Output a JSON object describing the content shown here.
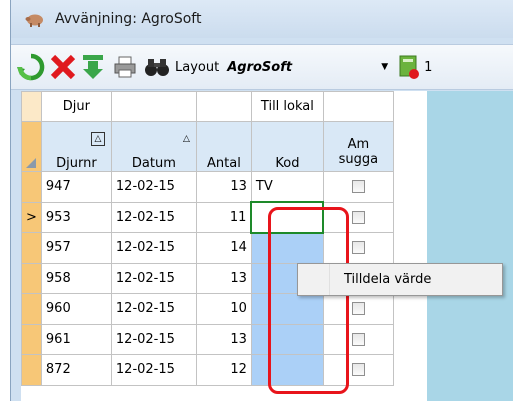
{
  "window": {
    "title": "Avvänjning: AgroSoft"
  },
  "toolbar": {
    "refresh_icon": "refresh-icon",
    "delete_icon": "delete-x-icon",
    "download_icon": "download-icon",
    "print_icon": "print-icon",
    "binoculars_icon": "binoculars-icon",
    "layout_label": "Layout",
    "layout_value": "AgroSoft",
    "trailing_text": "1"
  },
  "grid": {
    "group_headers": [
      "Djur",
      "",
      "",
      "Till lokal",
      ""
    ],
    "columns": [
      "Djurnr",
      "Datum",
      "Antal",
      "Kod",
      "Am sugga"
    ],
    "rows": [
      {
        "marker": "",
        "djurnr": "947",
        "datum": "12-02-15",
        "antal": "13",
        "kod": "TV"
      },
      {
        "marker": ">",
        "djurnr": "953",
        "datum": "12-02-15",
        "antal": "11",
        "kod": ""
      },
      {
        "marker": "",
        "djurnr": "957",
        "datum": "12-02-15",
        "antal": "14",
        "kod": ""
      },
      {
        "marker": "",
        "djurnr": "958",
        "datum": "12-02-15",
        "antal": "13",
        "kod": ""
      },
      {
        "marker": "",
        "djurnr": "960",
        "datum": "12-02-15",
        "antal": "10",
        "kod": ""
      },
      {
        "marker": "",
        "djurnr": "961",
        "datum": "12-02-15",
        "antal": "13",
        "kod": ""
      },
      {
        "marker": "",
        "djurnr": "872",
        "datum": "12-02-15",
        "antal": "12",
        "kod": ""
      }
    ]
  },
  "context_menu": {
    "item": "Tilldela värde"
  },
  "colors": {
    "row_header": "#f7c777",
    "selection": "#abd0f7",
    "highlight": "#e8141b",
    "edit_border": "#1e8a2a"
  }
}
